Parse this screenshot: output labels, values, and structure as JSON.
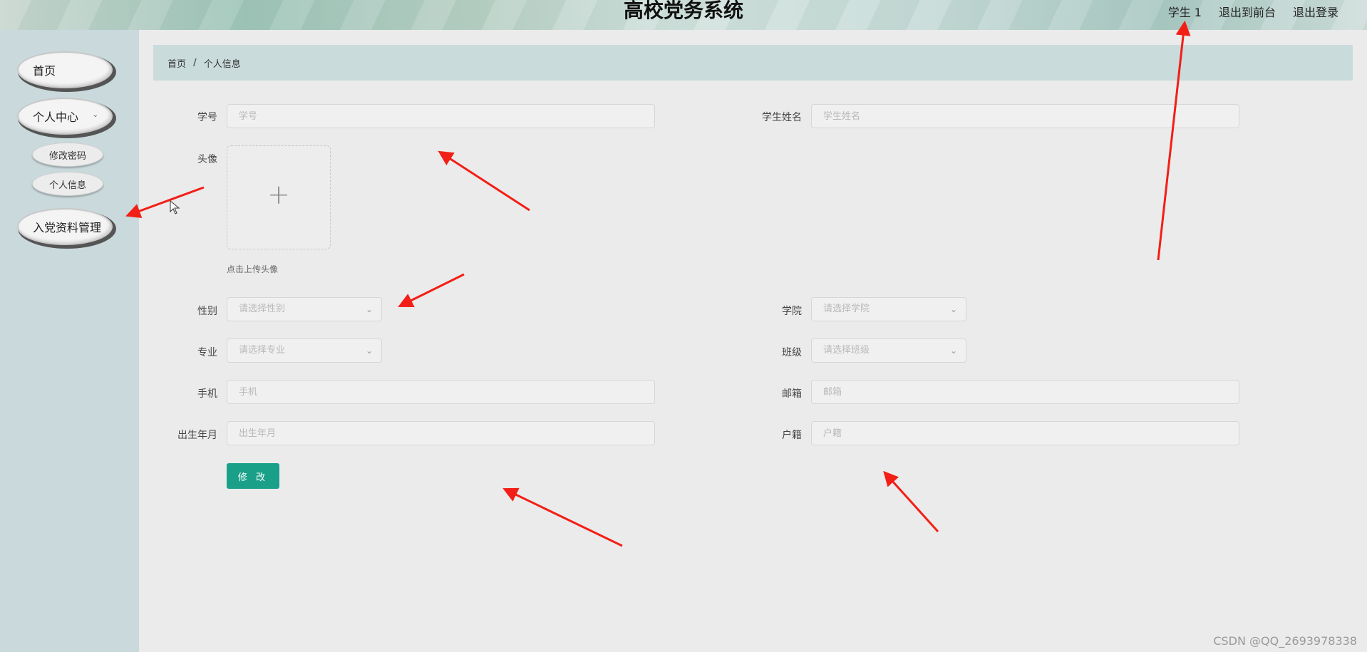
{
  "header": {
    "title": "高校党务系统",
    "user": "学生 1",
    "to_front": "退出到前台",
    "logout": "退出登录"
  },
  "sidebar": {
    "items": [
      {
        "label": "首页"
      },
      {
        "label": "个人中心",
        "children": [
          {
            "label": "修改密码"
          },
          {
            "label": "个人信息"
          }
        ]
      },
      {
        "label": "入党资料管理"
      }
    ]
  },
  "breadcrumb": {
    "home": "首页",
    "separator": "/",
    "current": "个人信息"
  },
  "form": {
    "student_no": {
      "label": "学号",
      "placeholder": "学号",
      "value": ""
    },
    "student_name": {
      "label": "学生姓名",
      "placeholder": "学生姓名",
      "value": ""
    },
    "avatar": {
      "label": "头像",
      "hint": "点击上传头像"
    },
    "gender": {
      "label": "性别",
      "placeholder": "请选择性别"
    },
    "college": {
      "label": "学院",
      "placeholder": "请选择学院"
    },
    "major": {
      "label": "专业",
      "placeholder": "请选择专业"
    },
    "class": {
      "label": "班级",
      "placeholder": "请选择班级"
    },
    "phone": {
      "label": "手机",
      "placeholder": "手机",
      "value": ""
    },
    "email": {
      "label": "邮箱",
      "placeholder": "邮箱",
      "value": ""
    },
    "birth": {
      "label": "出生年月",
      "placeholder": "出生年月",
      "value": ""
    },
    "hukou": {
      "label": "户籍",
      "placeholder": "户籍",
      "value": ""
    },
    "submit_label": "修 改"
  },
  "watermark": "CSDN @QQ_2693978338",
  "colors": {
    "accent": "#1aa089",
    "sidebar_bg": "#c9d9dc",
    "breadcrumb_bg": "#cadbdb",
    "arrow": "#f21f16"
  }
}
